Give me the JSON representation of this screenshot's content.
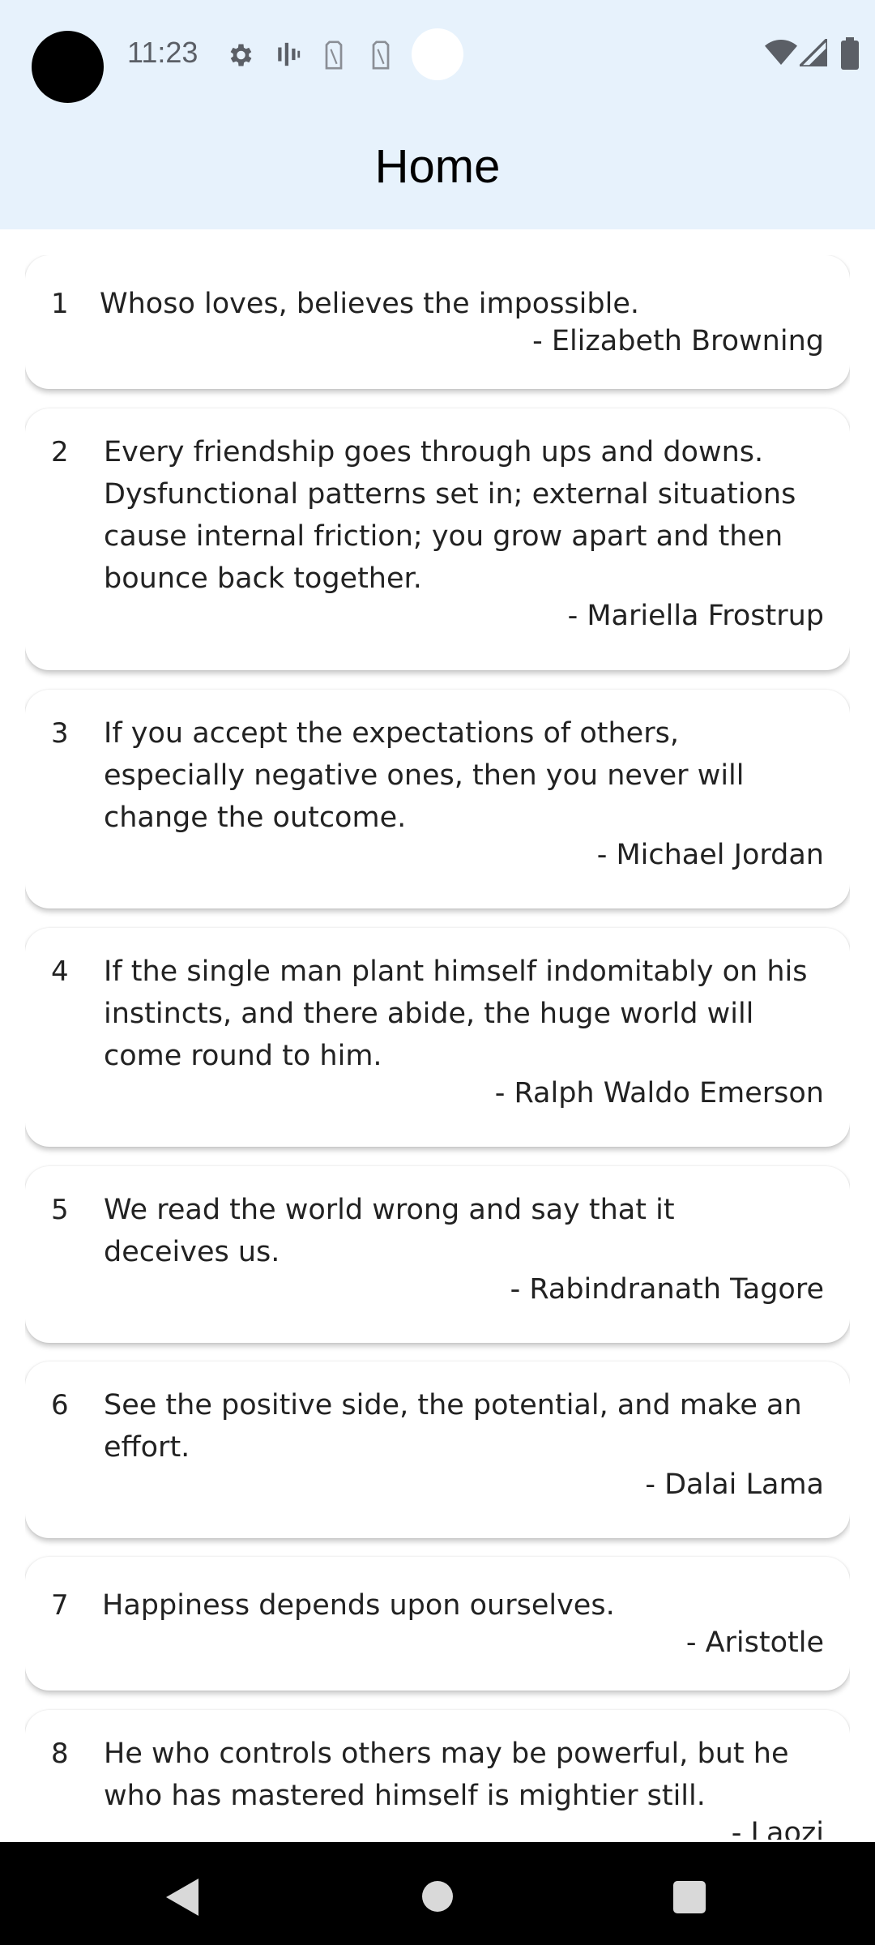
{
  "status_bar": {
    "time": "11:23",
    "icons": [
      "settings-icon",
      "signal-bars-icon",
      "sim-icon",
      "sim-icon",
      "wifi-icon",
      "cellular-icon",
      "battery-icon"
    ]
  },
  "app_bar": {
    "title": "Home"
  },
  "quotes": [
    {
      "number": "1",
      "lines": [
        "Whoso loves, believes the impossible."
      ],
      "author": "- Elizabeth Browning"
    },
    {
      "number": "2",
      "lines": [
        "Every friendship goes through ups and downs.",
        "Dysfunctional patterns set in; external situations",
        "cause internal friction; you grow apart and then",
        "bounce back together."
      ],
      "author": "- Mariella Frostrup"
    },
    {
      "number": "3",
      "lines": [
        "If you accept the expectations of others,",
        "especially negative ones, then you never will",
        "change the outcome."
      ],
      "author": "- Michael Jordan"
    },
    {
      "number": "4",
      "lines": [
        "If the single man plant himself indomitably on his",
        "instincts, and there abide, the huge world will",
        "come round to him."
      ],
      "author": "- Ralph Waldo Emerson"
    },
    {
      "number": "5",
      "lines": [
        "We read the world wrong and say that it",
        "deceives us."
      ],
      "author": "- Rabindranath Tagore"
    },
    {
      "number": "6",
      "lines": [
        "See the positive side, the potential, and make an",
        "effort."
      ],
      "author": "- Dalai Lama"
    },
    {
      "number": "7",
      "lines": [
        "Happiness depends upon ourselves."
      ],
      "author": "- Aristotle"
    },
    {
      "number": "8",
      "lines": [
        "He who controls others may be powerful, but he",
        "who has mastered himself is mightier still."
      ],
      "author": "- Laozi"
    }
  ],
  "nav_bar": {
    "icons": [
      "back-icon",
      "home-icon",
      "recents-icon"
    ]
  },
  "colors": {
    "app_bar_bg": "#e7f2fc",
    "card_bg": "#ffffff",
    "nav_bg": "#000000"
  }
}
